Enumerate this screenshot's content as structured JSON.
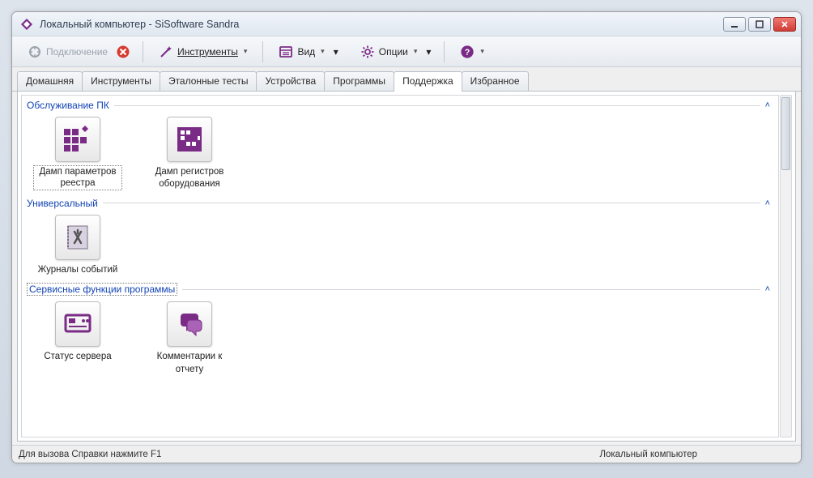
{
  "window": {
    "title": "Локальный компьютер - SiSoftware Sandra"
  },
  "toolbar": {
    "connect": "Подключение",
    "instruments": "Инструменты",
    "view": "Вид",
    "options": "Опции"
  },
  "tabs": [
    {
      "label": "Домашняя",
      "active": false
    },
    {
      "label": "Инструменты",
      "active": false
    },
    {
      "label": "Эталонные тесты",
      "active": false
    },
    {
      "label": "Устройства",
      "active": false
    },
    {
      "label": "Программы",
      "active": false
    },
    {
      "label": "Поддержка",
      "active": true
    },
    {
      "label": "Избранное",
      "active": false
    }
  ],
  "groups": [
    {
      "title": "Обслуживание ПК",
      "items": [
        {
          "label": "Дамп параметров реестра",
          "icon": "registry-dump-icon"
        },
        {
          "label": "Дамп регистров оборудования",
          "icon": "hardware-registers-icon"
        }
      ]
    },
    {
      "title": "Универсальный",
      "items": [
        {
          "label": "Журналы событий",
          "icon": "event-log-icon"
        }
      ]
    },
    {
      "title": "Сервисные функции программы",
      "items": [
        {
          "label": "Статус сервера",
          "icon": "server-status-icon"
        },
        {
          "label": "Комментарии к отчету",
          "icon": "report-comments-icon"
        }
      ]
    }
  ],
  "statusbar": {
    "hint": "Для вызова Справки нажмите F1",
    "right": "Локальный компьютер"
  },
  "colors": {
    "accent": "#7a2b86"
  }
}
